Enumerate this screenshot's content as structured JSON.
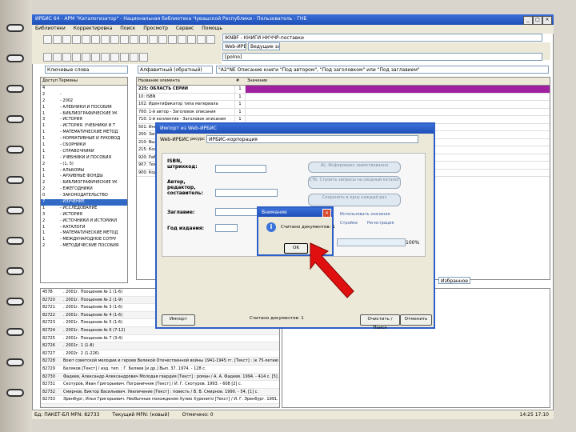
{
  "window": {
    "title": "ИРБИС 64 - АРМ \"Каталогизатор\" - Национальная библиотека Чувашской Республики - Пользователь - ГНБ"
  },
  "menu": [
    "Библиотеки",
    "Корректировка",
    "Поиск",
    "Просмотр",
    "Сервис",
    "Помощь"
  ],
  "toolbar_fields": {
    "search_type": "Ключевые слова",
    "mode": "Алфавитный (обратный)",
    "database": "IKNBF - КНИГИ НКЧЧР-поставки",
    "format": "[polno]",
    "query": "\"A2\"NE Описание книги \"Под автором\", \"Под заголовком\" или \"Под заглавием\""
  },
  "tabs": {
    "web_irbis": "Web-ИРБИС",
    "sub_tab": "Ведущие записи"
  },
  "left_list": {
    "header": "Доступ   Термины",
    "rows": [
      {
        "n": "4",
        "t": ""
      },
      {
        "n": "2",
        "t": "-"
      },
      {
        "n": "2",
        "t": "- 2002"
      },
      {
        "n": "1",
        "t": "- АЛЕБНИКИ И ПОСОБИЯ"
      },
      {
        "n": "1",
        "t": "- БИБЛИОГРАФИЧЕСКИЕ УК"
      },
      {
        "n": "3",
        "t": "- ИСТОРИЯ"
      },
      {
        "n": "1",
        "t": "- ИСТОРИЯ. УЧЕБНИКИ И Т"
      },
      {
        "n": "1",
        "t": "- МАТЕМАТИЧЕСКИЕ МЕТОД"
      },
      {
        "n": "1",
        "t": "- НОРМАТИВНЫЕ И РУКОВОД"
      },
      {
        "n": "1",
        "t": "- СБОРНИКИ"
      },
      {
        "n": "1",
        "t": "- СПРАВОЧНИКИ"
      },
      {
        "n": "1",
        "t": "- УЧЕБНИКИ И ПОСОБИЯ"
      },
      {
        "n": "2",
        "t": "- (1, 5)"
      },
      {
        "n": "1",
        "t": "- АЛЬБОМЫ"
      },
      {
        "n": "1",
        "t": "- АРХИВНЫЕ ФОНДЫ"
      },
      {
        "n": "2",
        "t": "- БИБЛИОГРАФИЧЕСКИЕ УК"
      },
      {
        "n": "2",
        "t": "- ЕЖЕГОДНИКИ"
      },
      {
        "n": "0",
        "t": "- ЗАКОНОДАТЕЛЬСТВО"
      },
      {
        "n": "7",
        "t": "- ИЗУЧЕНИЕ",
        "sel": true
      },
      {
        "n": "1",
        "t": "- ИССЛЕДОВАНИЕ"
      },
      {
        "n": "3",
        "t": "- ИСТОРИЯ"
      },
      {
        "n": "2",
        "t": "- ИСТОЧНИКИ И ИСТОРИКИ"
      },
      {
        "n": "1",
        "t": "- КАТАЛОГИ"
      },
      {
        "n": "1",
        "t": "- МАТЕМАТИЧЕСКИЕ МЕТОД"
      },
      {
        "n": "1",
        "t": "- МЕЖДУНАРОДНОЕ СОТРУ"
      },
      {
        "n": "2",
        "t": "- МЕТОДИЧЕСКИЕ ПОСОБИЯ"
      }
    ]
  },
  "field_grid": {
    "header_name": "Название элемента",
    "header_rep": "#",
    "header_value": "Значение",
    "rows": [
      {
        "name": "225: ОБЛАСТЬ СЕРИИ",
        "rep": "1"
      },
      {
        "name": "10: ISBN",
        "rep": "1"
      },
      {
        "name": "102: Идентификатор типа материала",
        "rep": "1"
      },
      {
        "name": "700: 1-й автор - Заголовок описания",
        "rep": "1"
      },
      {
        "name": "710: 1-й коллектив - Заголовок описания",
        "rep": "1"
      },
      {
        "name": "501: Информация ",
        "rep": "1"
      },
      {
        "name": "200: Заглавие",
        "rep": "1"
      },
      {
        "name": "210: Выходные данные",
        "rep": "1"
      },
      {
        "name": "215: Количественные",
        "rep": "1"
      },
      {
        "name": "920: Рабочий лист",
        "rep": "1"
      },
      {
        "name": "907: Технология",
        "rep": "1"
      },
      {
        "name": "900: Коды",
        "rep": "1"
      }
    ]
  },
  "bottom_list": {
    "rows": [
      {
        "c": "4578",
        "t": ". 2001г. Поощение № 1 (1-6)"
      },
      {
        "c": "82720",
        "t": ". 2001г. Поощение № 2 (1-9)"
      },
      {
        "c": "82721",
        "t": ". 2001г. Поощение № 3 (1-6)"
      },
      {
        "c": "82722",
        "t": ". 2001г. Поощение № 4 (1-6)"
      },
      {
        "c": "82723",
        "t": ". 2001г. Поощение № 5 (1-6)"
      },
      {
        "c": "82724",
        "t": ". 2001г. Поощение № 6 (7-12)"
      },
      {
        "c": "82725",
        "t": ". 2001г. Поощение № 7 (3-4)"
      },
      {
        "c": "82726",
        "t": ". 2001г. 1 (1-8)"
      },
      {
        "c": "82727",
        "t": ". 2002г. 2 (1-226)"
      },
      {
        "c": "82728",
        "t": "Воют советской мелодии и героев Великой Отечественной войны 1941-1945 гг. [Текст] : (к 75-летию со дня рождения Г. И. Смирнова)"
      },
      {
        "c": "82729",
        "t": "Беляков [Текст] / изд. тип. ; Г. Беляев [и др.] Вып. 37. 1974. - 128 с."
      },
      {
        "c": "82730",
        "t": "Фадеев, Александр Александрович Молодая гвардия [Текст] : роман / А. А. Фадеев. 1994. - 414 с. [5] л. ил."
      },
      {
        "c": "82731",
        "t": "Скотуров, Иван Григорьевич. Пограничник [Текст] / И. Г. Скотуров. 1993. - 608 [2] с."
      },
      {
        "c": "82732",
        "t": "Смирнов, Виктор Васильевич. Увеличение [Текст] : повесть / В. В. Смирнов. 1990. - 54, [1] с."
      },
      {
        "c": "82733",
        "t": "Эренбург, Илья Григорьевич. Необычные похождения Хулио Хуренито [Текст] / И. Г. Эренбург. 1991. - 355, [2] с."
      },
      {
        "c": "",
        "t": "(новый)",
        "sel": true
      }
    ]
  },
  "right_tabs": {
    "tab": "Избранное"
  },
  "status": {
    "left": "Бд: ПАКЕТ-БЛ  МFN: 82733",
    "mid": "Текущий МFN: (новый)",
    "right": "Отмечено: 0",
    "time": "14:25   17:10"
  },
  "dialog": {
    "title": "Импорт из Web-ИРБИС",
    "web_label": "Web-ИРБИС",
    "resource_label": "ресурс",
    "resource_value": "ИРБИС-корпорация",
    "isbn_label": "ISBN,\nштрихкод:",
    "author_label": "Автор,\nредактор,\nсоставитель:",
    "title_label": "Заглавие:",
    "year_label": "Год издания:",
    "pill1": "AL: Инфоромакс заимствованно",
    "pill2": "СТБ: Строить запросы на сводный каталог",
    "pill3": "Сохранить в одну каждый раз",
    "pill4": "Использовать значения",
    "link1": "Стройке",
    "link2": "Регистрация",
    "progress": "100%",
    "btn_import": "Импорт",
    "found": "Считано документов: 1",
    "btn_search": "Очистить / Поиск",
    "btn_cancel": "Отменить"
  },
  "message": {
    "title": "Внимание",
    "text": "Считано документов: 1",
    "ok": "OK"
  },
  "colors": {
    "accent": "#1f4fb8",
    "selection": "#316ac5",
    "highlight": "#a020a0",
    "arrow": "#e01010"
  }
}
